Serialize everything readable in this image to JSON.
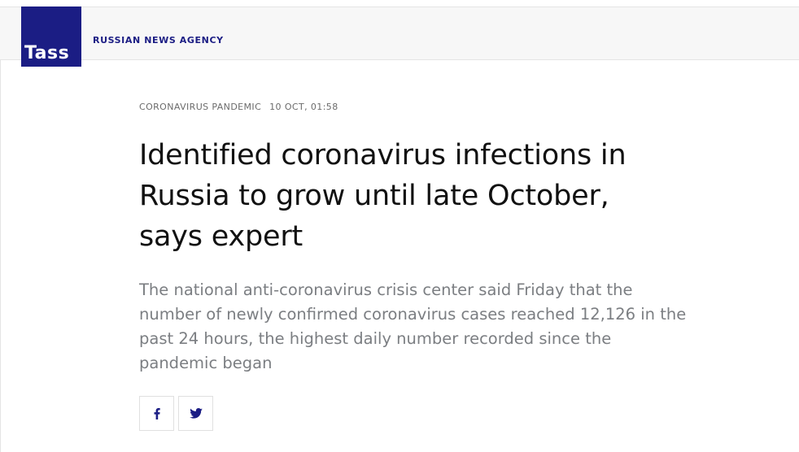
{
  "header": {
    "logo_text": "Tass",
    "agency_name": "RUSSIAN NEWS AGENCY"
  },
  "article": {
    "category": "CORONAVIRUS PANDEMIC",
    "timestamp": "10 OCT, 01:58",
    "headline": "Identified coronavirus infections in Russia to grow until late October, says expert",
    "lead": "The national anti-coronavirus crisis center said Friday that the number of newly confirmed coronavirus cases reached 12,126 in the past 24 hours, the highest daily number recorded since the pandemic began"
  },
  "share": {
    "buttons": [
      {
        "icon": "facebook-icon"
      },
      {
        "icon": "twitter-icon"
      }
    ]
  },
  "colors": {
    "brand": "#1b1d84",
    "lead_text": "#7b7e82",
    "meta_text": "#6b6b6b",
    "header_bg": "#f7f7f7"
  }
}
